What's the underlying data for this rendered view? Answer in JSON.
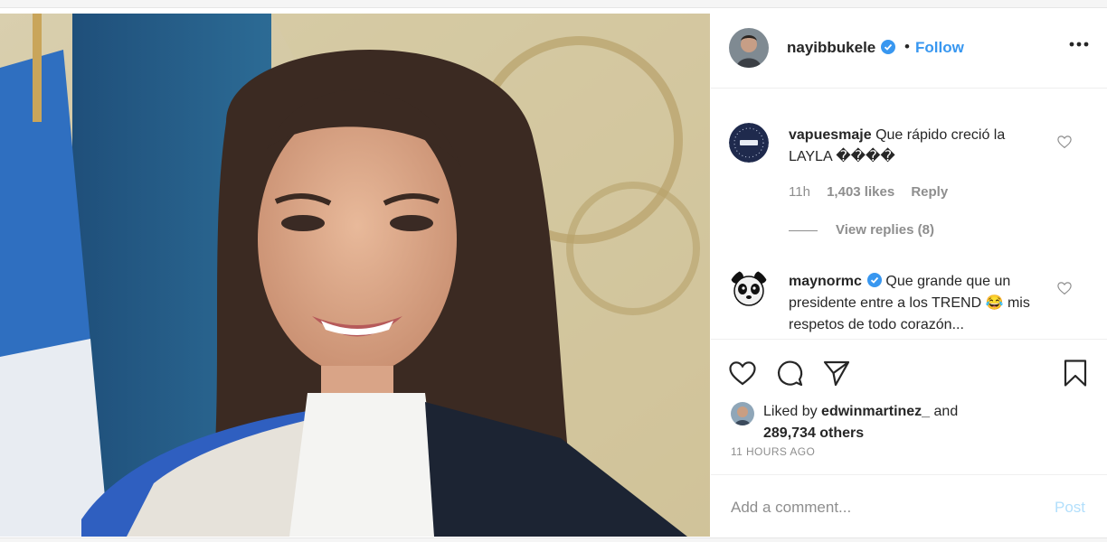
{
  "post": {
    "author": {
      "username": "nayibbukele",
      "verified": true,
      "separator": "•",
      "follow_label": "Follow",
      "more_icon": "more-horizontal-icon"
    },
    "comments": [
      {
        "username": "vapuesmaje",
        "text": "Que rápido creció la LAYLA ����",
        "time": "11h",
        "likes": "1,403 likes",
        "reply_label": "Reply",
        "view_replies": "View replies (8)",
        "avatar_icon": "navy-circle-avatar"
      },
      {
        "username": "maynormc",
        "verified": true,
        "text": "Que grande que un presidente entre a los TREND 😂 mis respetos de todo corazón...",
        "avatar_icon": "panda-avatar"
      }
    ],
    "actions": {
      "like_icon": "heart-icon",
      "comment_icon": "comment-icon",
      "share_icon": "share-icon",
      "save_icon": "bookmark-icon"
    },
    "liked_by": {
      "prefix": "Liked by",
      "user": "edwinmartinez_",
      "and": "and",
      "others": "289,734 others"
    },
    "timestamp": "11 HOURS AGO",
    "add_comment": {
      "placeholder": "Add a comment...",
      "post_label": "Post"
    }
  },
  "colors": {
    "link_blue": "#3897f0",
    "post_disabled": "#b2dffc",
    "muted": "#8e8e8e",
    "verified_blue": "#3897f0"
  }
}
